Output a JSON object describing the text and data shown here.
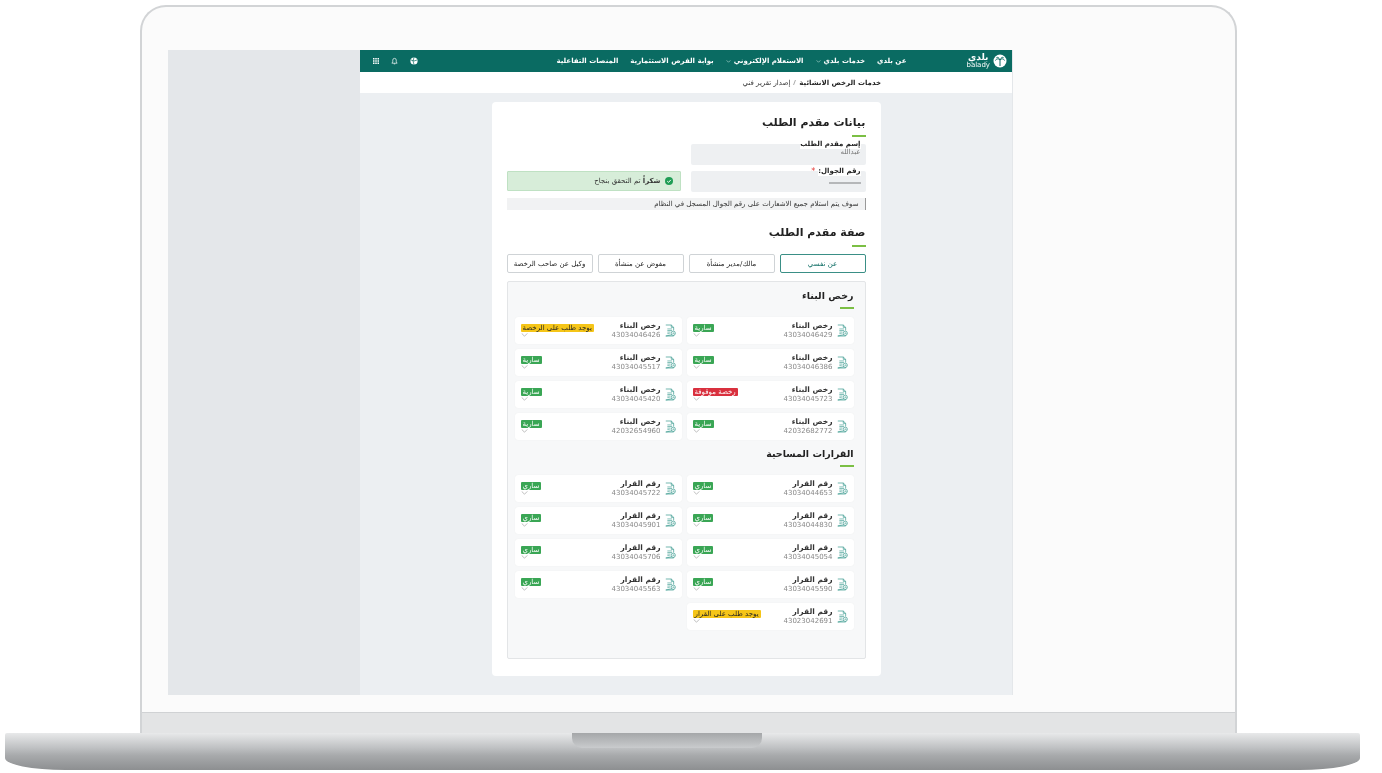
{
  "header": {
    "logo_text": "بلدي",
    "logo_subtext": "balady",
    "nav": [
      {
        "label": "عن بلدي",
        "dropdown": false
      },
      {
        "label": "خدمات بلدي",
        "dropdown": true
      },
      {
        "label": "الاستعلام الإلكتروني",
        "dropdown": true
      },
      {
        "label": "بوابة الفرص الاستثمارية",
        "dropdown": false
      },
      {
        "label": "المنصات التفاعلية",
        "dropdown": false
      }
    ]
  },
  "breadcrumb": [
    "خدمات الرخص الانشائية",
    "إصدار تقرير فني"
  ],
  "applicant": {
    "title": "بيانات مقدم الطلب",
    "name_field": {
      "label": "إسم مقدم الطلب",
      "value": "عبدالله"
    },
    "mobile_field": {
      "label": "رقم الجوال:",
      "required_mark": "*",
      "value_masked": true
    },
    "alert": "**شكراً** تم التحقق بنجاح",
    "note": "سوف يتم استلام جميع الاشعارات على رقم الجوال المسجل في النظام"
  },
  "capacity": {
    "title": "صفة مقدم الطلب",
    "options": [
      {
        "label": "عن نفسي",
        "selected": true
      },
      {
        "label": "مالك/مدير منشأة",
        "selected": false
      },
      {
        "label": "مفوض عن منشأة",
        "selected": false
      },
      {
        "label": "وكيل عن صاحب الرخصة",
        "selected": false
      }
    ]
  },
  "sections": [
    {
      "title": "رخص البناء",
      "items": [
        {
          "title": "رخص البناء",
          "number": "43034046429",
          "status": "سارية",
          "color": "#3aa655"
        },
        {
          "title": "رخص البناء",
          "number": "43034046426",
          "status": "يوجد طلب على الرخصة",
          "color": "#f5c518"
        },
        {
          "title": "رخص البناء",
          "number": "43034046386",
          "status": "سارية",
          "color": "#3aa655"
        },
        {
          "title": "رخص البناء",
          "number": "43034045517",
          "status": "سارية",
          "color": "#3aa655"
        },
        {
          "title": "رخص البناء",
          "number": "43034045723",
          "status": "رخصة موقوفة",
          "color": "#d9303e"
        },
        {
          "title": "رخص البناء",
          "number": "43034045420",
          "status": "سارية",
          "color": "#3aa655"
        },
        {
          "title": "رخص البناء",
          "number": "42032682772",
          "status": "سارية",
          "color": "#3aa655"
        },
        {
          "title": "رخص البناء",
          "number": "42032654960",
          "status": "سارية",
          "color": "#3aa655"
        }
      ]
    },
    {
      "title": "القرارات المساحية",
      "items": [
        {
          "title": "رقم القرار",
          "number": "43034044653",
          "status": "ساري",
          "color": "#3aa655"
        },
        {
          "title": "رقم القرار",
          "number": "43034045722",
          "status": "ساري",
          "color": "#3aa655"
        },
        {
          "title": "رقم القرار",
          "number": "43034044830",
          "status": "ساري",
          "color": "#3aa655"
        },
        {
          "title": "رقم القرار",
          "number": "43034045901",
          "status": "ساري",
          "color": "#3aa655"
        },
        {
          "title": "رقم القرار",
          "number": "43034045054",
          "status": "ساري",
          "color": "#3aa655"
        },
        {
          "title": "رقم القرار",
          "number": "43034045706",
          "status": "ساري",
          "color": "#3aa655"
        },
        {
          "title": "رقم القرار",
          "number": "43034045590",
          "status": "ساري",
          "color": "#3aa655"
        },
        {
          "title": "رقم القرار",
          "number": "43034045563",
          "status": "ساري",
          "color": "#3aa655"
        },
        {
          "title": "رقم القرار",
          "number": "43023042691",
          "status": "يوجد طلب على القرار",
          "color": "#f5c518"
        }
      ]
    }
  ]
}
